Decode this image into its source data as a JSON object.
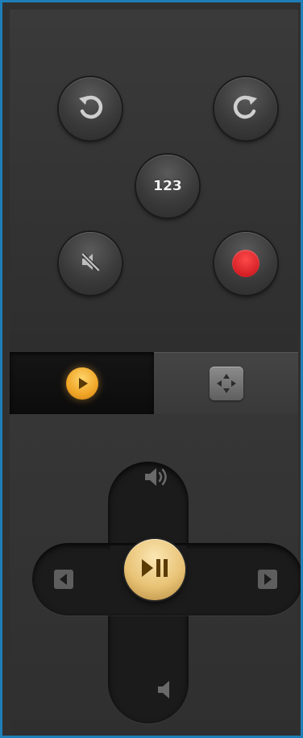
{
  "app": {
    "frame_color": "#1e7fb8",
    "background": "#303030"
  },
  "buttons": {
    "rewind_icon": "rotate-counterclockwise-icon",
    "forward_icon": "rotate-clockwise-icon",
    "numpad_label": "123",
    "mute_icon": "mute-icon",
    "record_icon": "record-icon",
    "record_color": "#d41f25"
  },
  "mode_tabs": {
    "active": "playback",
    "items": [
      {
        "id": "playback",
        "icon": "play-icon",
        "accent": "#f0a526"
      },
      {
        "id": "navigation",
        "icon": "dpad-arrows-icon"
      }
    ]
  },
  "dpad": {
    "up_icon": "volume-up-icon",
    "down_icon": "volume-down-icon",
    "left_icon": "arrow-left-icon",
    "right_icon": "arrow-right-icon",
    "center_icon": "play-pause-icon",
    "center_color": "#e8c376"
  }
}
